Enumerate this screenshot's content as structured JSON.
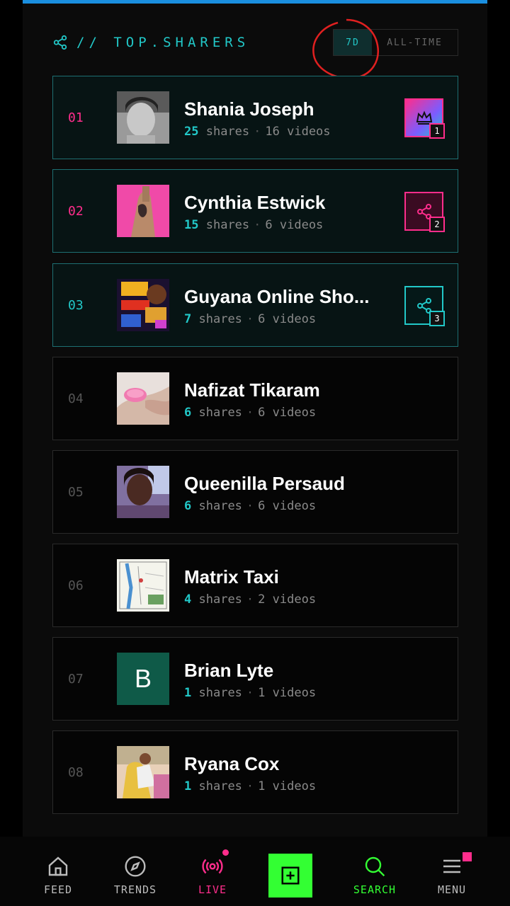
{
  "header": {
    "title": "// TOP.SHARERS",
    "toggle": {
      "active": "7D",
      "inactive": "ALL-TIME"
    }
  },
  "rows": [
    {
      "rank": "01",
      "name": "Shania Joseph",
      "shares": "25",
      "shares_label": "shares",
      "videos": "16 videos",
      "badge": "1",
      "badge_icon": "crown-icon"
    },
    {
      "rank": "02",
      "name": "Cynthia Estwick",
      "shares": "15",
      "shares_label": "shares",
      "videos": "6 videos",
      "badge": "2",
      "badge_icon": "share-icon"
    },
    {
      "rank": "03",
      "name": "Guyana Online Sho...",
      "shares": "7",
      "shares_label": "shares",
      "videos": "6 videos",
      "badge": "3",
      "badge_icon": "share-icon"
    },
    {
      "rank": "04",
      "name": "Nafizat Tikaram",
      "shares": "6",
      "shares_label": "shares",
      "videos": "6 videos"
    },
    {
      "rank": "05",
      "name": "Queenilla Persaud",
      "shares": "6",
      "shares_label": "shares",
      "videos": "6 videos"
    },
    {
      "rank": "06",
      "name": "Matrix Taxi",
      "shares": "4",
      "shares_label": "shares",
      "videos": "2 videos"
    },
    {
      "rank": "07",
      "name": "Brian Lyte",
      "shares": "1",
      "shares_label": "shares",
      "videos": "1 videos",
      "avatar_letter": "B"
    },
    {
      "rank": "08",
      "name": "Ryana Cox",
      "shares": "1",
      "shares_label": "shares",
      "videos": "1 videos"
    }
  ],
  "nav": {
    "feed": "FEED",
    "trends": "TRENDS",
    "live": "LIVE",
    "search": "SEARCH",
    "menu": "MENU"
  },
  "colors": {
    "accent_cyan": "#22c8c8",
    "accent_pink": "#ff2d8c",
    "create_green": "#33ff33"
  }
}
